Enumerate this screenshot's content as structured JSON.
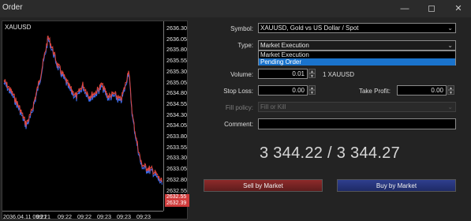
{
  "window": {
    "title": "Order",
    "minimize_glyph": "—",
    "close_glyph": "✕"
  },
  "chart": {
    "symbol": "XAUUSD",
    "price_ticks": [
      "2636.30",
      "2636.05",
      "2635.80",
      "2635.55",
      "2635.30",
      "2635.05",
      "2634.80",
      "2634.55",
      "2634.30",
      "2634.05",
      "2633.80",
      "2633.55",
      "2633.30",
      "2633.05",
      "2632.80",
      "2632.55",
      "2632.30"
    ],
    "ask_tag": "2632.55",
    "bid_tag": "2632.39",
    "time_ticks": [
      "2036.04.11 09:21",
      "09:21",
      "09:22",
      "09:22",
      "09:23",
      "09:23",
      "09:23"
    ],
    "colors": {
      "bid_line": "#3a6df0",
      "ask_line": "#e0463c",
      "background": "#000000"
    }
  },
  "form": {
    "symbol_label": "Symbol:",
    "symbol_value": "XAUUSD, Gold vs US Dollar / Spot",
    "type_label": "Type:",
    "type_value": "Market Execution",
    "type_options": [
      "Market Execution",
      "Pending Order"
    ],
    "volume_label": "Volume:",
    "volume_value": "0.01",
    "volume_unit": "1 XAUUSD",
    "stop_loss_label": "Stop Loss:",
    "stop_loss_value": "0.00",
    "take_profit_label": "Take Profit:",
    "take_profit_value": "0.00",
    "fill_policy_label": "Fill policy:",
    "fill_policy_value": "Fill or Kill",
    "comment_label": "Comment:",
    "comment_value": ""
  },
  "quote": {
    "text": "3 344.22 / 3 344.27"
  },
  "buttons": {
    "sell": "Sell by Market",
    "buy": "Buy by Market"
  }
}
